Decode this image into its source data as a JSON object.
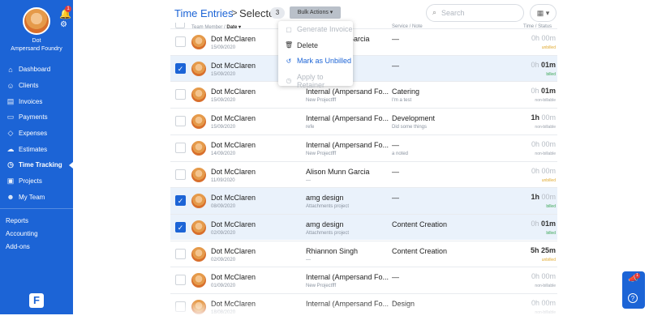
{
  "sidebar": {
    "notifications_count": "1",
    "user_name": "Dot",
    "org_name": "Ampersand Foundry",
    "items": [
      {
        "label": "Dashboard",
        "icon": "dashboard-icon",
        "glyph": "⌂"
      },
      {
        "label": "Clients",
        "icon": "clients-icon",
        "glyph": "☺"
      },
      {
        "label": "Invoices",
        "icon": "invoices-icon",
        "glyph": "▤"
      },
      {
        "label": "Payments",
        "icon": "payments-icon",
        "glyph": "▭"
      },
      {
        "label": "Expenses",
        "icon": "expenses-icon",
        "glyph": "◇"
      },
      {
        "label": "Estimates",
        "icon": "estimates-icon",
        "glyph": "☁"
      },
      {
        "label": "Time Tracking",
        "icon": "clock-icon",
        "glyph": "◷"
      },
      {
        "label": "Projects",
        "icon": "projects-icon",
        "glyph": "▣"
      },
      {
        "label": "My Team",
        "icon": "team-icon",
        "glyph": "☻"
      }
    ],
    "secondary_items": [
      "Reports",
      "Accounting",
      "Add-ons"
    ],
    "logo_letter": "F"
  },
  "header": {
    "title": "Time Entries",
    "separator": ">",
    "selected_label": "Selected",
    "selected_count": "3",
    "bulk_actions_label": "Bulk Actions ▾",
    "search_placeholder": "Search"
  },
  "columns": {
    "member": "Team Member /",
    "date": "Date ▾",
    "service": "Service / Note",
    "time": "Time / Status"
  },
  "bulk_menu": [
    {
      "label": "Generate Invoice",
      "icon": "invoice-icon",
      "glyph": "▢",
      "state": "disabled"
    },
    {
      "label": "Delete",
      "icon": "trash-icon",
      "glyph": "🗑",
      "state": "normal"
    },
    {
      "label": "Mark as Unbilled",
      "icon": "undo-icon",
      "glyph": "↺",
      "state": "accent"
    },
    {
      "label": "Apply to Retainer",
      "icon": "retainer-icon",
      "glyph": "◷",
      "state": "disabled"
    }
  ],
  "rows": [
    {
      "member": "Dot McClaren",
      "date": "15/09/2020",
      "client": "Alison Munn Garcia",
      "project": "",
      "service": "—",
      "note": "",
      "hours": "0h",
      "minutes": "00m",
      "status": "unbilled",
      "status_color": "#e0a92e",
      "checked": false
    },
    {
      "member": "Dot McClaren",
      "date": "15/09/2020",
      "client": "—",
      "project": "",
      "service": "—",
      "note": "",
      "hours": "0h",
      "minutes": "01m",
      "status": "billed",
      "status_color": "#3aa655",
      "checked": true
    },
    {
      "member": "Dot McClaren",
      "date": "15/09/2020",
      "client": "Internal (Ampersand Fo...",
      "project": "New Projectfff",
      "service": "Catering",
      "note": "I'm a test",
      "hours": "0h",
      "minutes": "01m",
      "status": "non-billable",
      "status_color": "#9aa1ab",
      "checked": false
    },
    {
      "member": "Dot McClaren",
      "date": "15/09/2020",
      "client": "Internal (Ampersand Fo...",
      "project": "refe",
      "service": "Development",
      "note": "Did some things",
      "hours": "1h",
      "minutes": "00m",
      "status": "non-billable",
      "status_color": "#9aa1ab",
      "checked": false
    },
    {
      "member": "Dot McClaren",
      "date": "14/09/2020",
      "client": "Internal (Ampersand Fo...",
      "project": "New Projectfff",
      "service": "—",
      "note": "a noted",
      "hours": "0h",
      "minutes": "00m",
      "status": "non-billable",
      "status_color": "#9aa1ab",
      "checked": false
    },
    {
      "member": "Dot McClaren",
      "date": "11/09/2020",
      "client": "Alison Munn Garcia",
      "project": "—",
      "service": "—",
      "note": "",
      "hours": "0h",
      "minutes": "00m",
      "status": "unbilled",
      "status_color": "#e0a92e",
      "checked": false
    },
    {
      "member": "Dot McClaren",
      "date": "08/09/2020",
      "client": "amg design",
      "project": "Attachments project",
      "service": "—",
      "note": "",
      "hours": "1h",
      "minutes": "00m",
      "status": "billed",
      "status_color": "#3aa655",
      "checked": true
    },
    {
      "member": "Dot McClaren",
      "date": "02/09/2020",
      "client": "amg design",
      "project": "Attachments project",
      "service": "Content Creation",
      "note": "",
      "hours": "0h",
      "minutes": "01m",
      "status": "billed",
      "status_color": "#3aa655",
      "checked": true
    },
    {
      "member": "Dot McClaren",
      "date": "02/09/2020",
      "client": "Rhiannon Singh",
      "project": "—",
      "service": "Content Creation",
      "note": "",
      "hours": "5h",
      "minutes": "25m",
      "status": "unbilled",
      "status_color": "#e0a92e",
      "checked": false
    },
    {
      "member": "Dot McClaren",
      "date": "01/09/2020",
      "client": "Internal (Ampersand Fo...",
      "project": "New Projectfff",
      "service": "—",
      "note": "",
      "hours": "0h",
      "minutes": "00m",
      "status": "non-billable",
      "status_color": "#9aa1ab",
      "checked": false
    },
    {
      "member": "Dot McClaren",
      "date": "18/08/2020",
      "client": "Internal (Ampersand Fo...",
      "project": "",
      "service": "Design",
      "note": "",
      "hours": "0h",
      "minutes": "00m",
      "status": "non-billable",
      "status_color": "#9aa1ab",
      "checked": false
    }
  ],
  "float": {
    "badge": "1",
    "help": "?"
  }
}
